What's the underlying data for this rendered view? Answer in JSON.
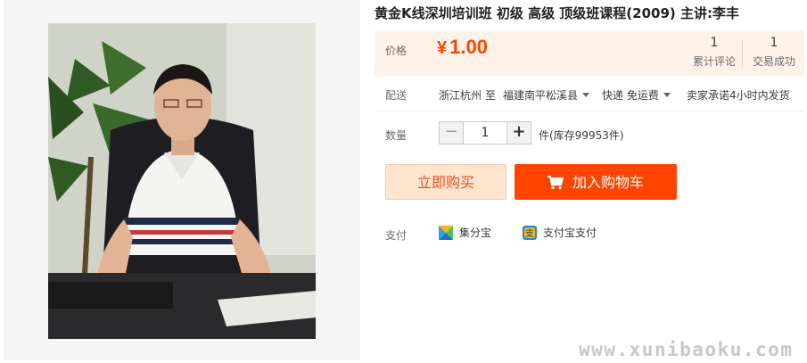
{
  "product": {
    "title": "黄金K线深圳培训班 初级 高级 顶级班课程(2009) 主讲:李丰"
  },
  "price": {
    "label": "价格",
    "currency_symbol": "¥",
    "amount": "1.00",
    "color": "#ff4400"
  },
  "stats": {
    "reviews_count": "1",
    "reviews_label": "累计评论",
    "deals_count": "1",
    "deals_label": "交易成功"
  },
  "shipping": {
    "label": "配送",
    "from": "浙江杭州",
    "to_word": "至",
    "destination": "福建南平松溪县",
    "method": "快递 免运费",
    "promise": "卖家承诺4小时内发货"
  },
  "quantity": {
    "label": "数量",
    "minus": "−",
    "value": "1",
    "plus": "+",
    "stock": "件(库存99953件)"
  },
  "actions": {
    "buy_now": "立即购买",
    "add_to_cart": "加入购物车"
  },
  "payment": {
    "label": "支付",
    "methods": [
      {
        "name": "集分宝",
        "icon": "jifenbao-icon"
      },
      {
        "name": "支付宝支付",
        "icon": "alipay-icon"
      }
    ]
  },
  "watermark": "www.xunibaoku.com"
}
